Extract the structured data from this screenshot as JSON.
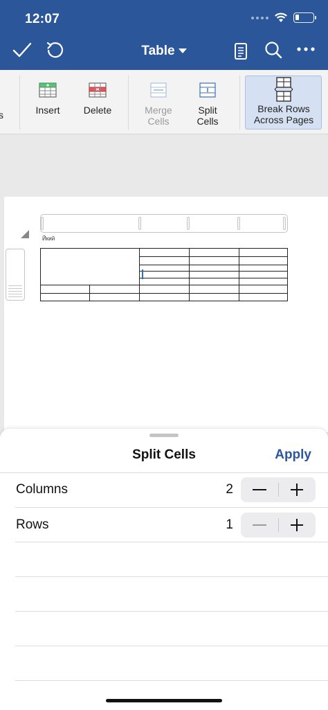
{
  "status_bar": {
    "time": "12:07"
  },
  "nav": {
    "title": "Table"
  },
  "ribbon": {
    "items": [
      {
        "label": "Insert",
        "enabled": true,
        "icon": "table-insert-icon"
      },
      {
        "label": "Delete",
        "enabled": true,
        "icon": "table-delete-icon"
      },
      {
        "label": "Merge Cells",
        "line1": "Merge",
        "line2": "Cells",
        "enabled": false,
        "icon": "merge-cells-icon"
      },
      {
        "label": "Split Cells",
        "line1": "Split",
        "line2": "Cells",
        "enabled": true,
        "icon": "split-cells-icon"
      },
      {
        "label": "Break Rows Across Pages",
        "line1": "Break Rows",
        "line2": "Across Pages",
        "enabled": true,
        "active": true,
        "icon": "break-rows-icon"
      }
    ],
    "clipped_label": "s"
  },
  "document": {
    "text": "Йкий"
  },
  "sheet": {
    "title": "Split Cells",
    "apply_label": "Apply",
    "rows": [
      {
        "label": "Columns",
        "value": "2"
      },
      {
        "label": "Rows",
        "value": "1"
      }
    ]
  },
  "colors": {
    "accent": "#2b579a",
    "ribbon_bg": "#f3f3f3",
    "active_bg": "#d5e1f2",
    "canvas_bg": "#e9e9e9"
  }
}
